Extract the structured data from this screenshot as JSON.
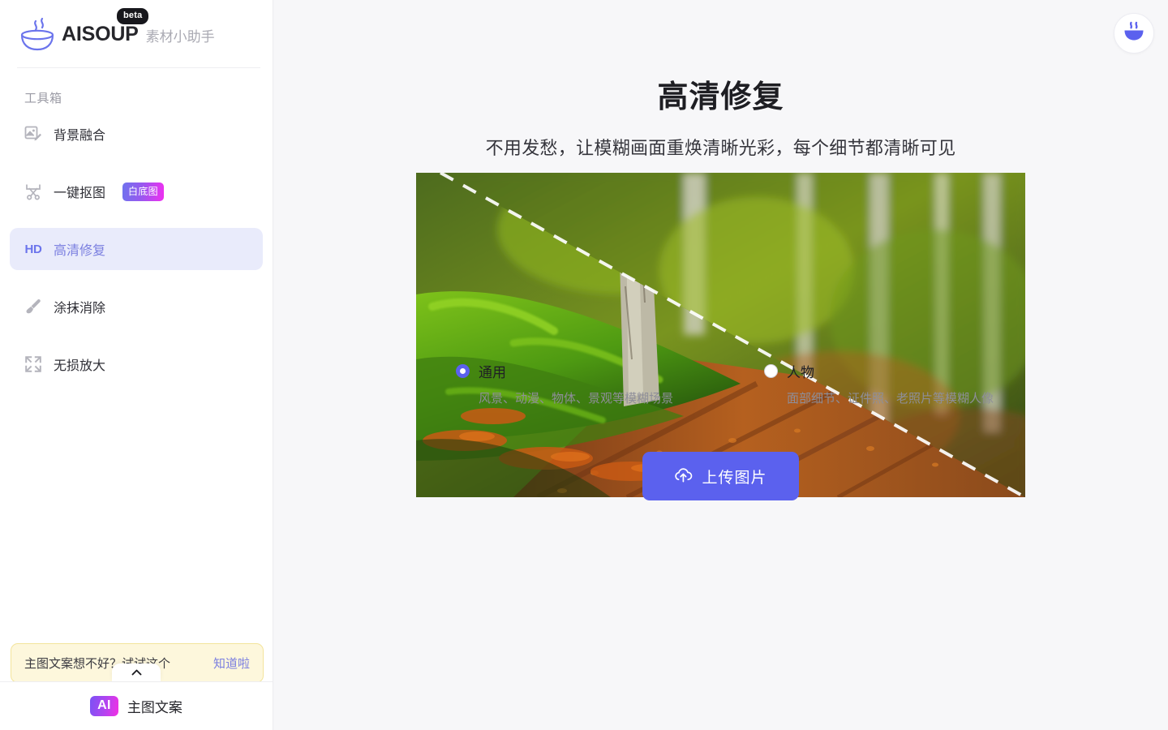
{
  "brand": {
    "name": "AISOUP",
    "sub": "素材小助手",
    "badge": "beta"
  },
  "sidebar": {
    "section_title": "工具箱",
    "items": [
      {
        "label": "背景融合",
        "icon": "image-edit-icon",
        "mark": "",
        "badge": "",
        "active": false
      },
      {
        "label": "一键抠图",
        "icon": "scissors-icon",
        "mark": "",
        "badge": "白底图",
        "active": false
      },
      {
        "label": "高清修复",
        "icon": "hd-text-icon",
        "mark": "HD",
        "badge": "",
        "active": true
      },
      {
        "label": "涂抹消除",
        "icon": "brush-icon",
        "mark": "",
        "badge": "",
        "active": false
      },
      {
        "label": "无损放大",
        "icon": "expand-arrows-icon",
        "mark": "",
        "badge": "",
        "active": false
      }
    ],
    "tooltip": {
      "text": "主图文案想不好？试试这个",
      "link": "知道啦"
    },
    "collapse_icon": "chevron-up-icon",
    "footer": {
      "badge": "AI",
      "label": "主图文案"
    }
  },
  "header": {
    "avatar_icon": "soup-bowl-icon"
  },
  "main": {
    "title": "高清修复",
    "subtitle": "不用发愁，让模糊画面重焕清晰光彩，每个细节都清晰可见",
    "preview": {
      "alt": "森林小径前后对比预览图",
      "divider": "diagonal-dashed-divider"
    },
    "options": [
      {
        "name": "通用",
        "desc": "风景、动漫、物体、景观等模糊场景",
        "selected": true
      },
      {
        "name": "人物",
        "desc": "面部细节、证件照、老照片等模糊人像",
        "selected": false
      }
    ],
    "upload": {
      "label": "上传图片",
      "icon": "cloud-upload-icon"
    }
  },
  "colors": {
    "accent": "#5b61ee",
    "accent_soft": "#e9ebfb",
    "badge_gradient_start": "#6f73ee",
    "badge_gradient_end": "#f02ff0",
    "tip_bg": "#fdf7dc",
    "tip_border": "#f3e49c",
    "main_bg": "#f7f7f9"
  }
}
